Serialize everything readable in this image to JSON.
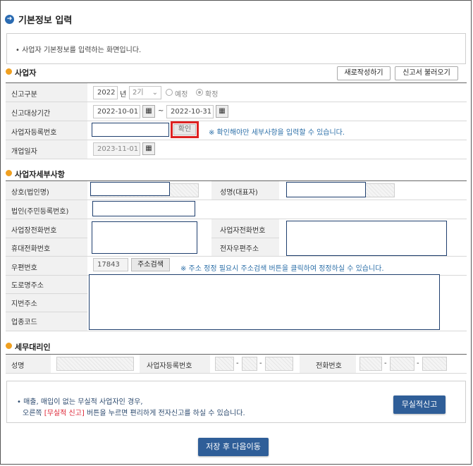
{
  "page": {
    "title": "기본정보 입력",
    "info": "사업자 기본정보를 입력하는 화면입니다."
  },
  "business": {
    "section_title": "사업자",
    "new_button": "새로작성하기",
    "load_button": "신고서 불러오기",
    "report_type": {
      "label": "신고구분",
      "year": "2022",
      "year_suffix": "년",
      "period": "2기",
      "options": [
        "예정",
        "확정"
      ],
      "selected": "확정"
    },
    "report_period": {
      "label": "신고대상기간",
      "start": "2022-10-01",
      "tilde": "~",
      "end": "2022-10-31"
    },
    "reg_number": {
      "label": "사업자등록번호",
      "value": "",
      "confirm_button": "확인",
      "note": "※ 확인해야만 세부사항을 입력할 수 있습니다."
    },
    "open_date": {
      "label": "개업일자",
      "value": "2023-11-01"
    }
  },
  "detail": {
    "section_title": "사업자세부사항",
    "company_name": "상호(법인명)",
    "rep_name": "성명(대표자)",
    "corp_number": "법인(주민등록번호)",
    "biz_phone": "사업장전화번호",
    "biz_owner_phone": "사업자전화번호",
    "mobile": "휴대전화번호",
    "email": "전자우편주소",
    "zip_label": "우편번호",
    "zip_value": "17843",
    "address_search": "주소검색",
    "address_note": "※ 주소 정정 필요시 주소검색 버튼을 클릭하여 정정하실 수 있습니다.",
    "road_address": "도로명주소",
    "lot_address": "지번주소",
    "business_code": "업종코드"
  },
  "tax_agent": {
    "section_title": "세무대리인",
    "name": "성명",
    "reg_number": "사업자등록번호",
    "phone": "전화번호",
    "dash": "-"
  },
  "bottom": {
    "line1": "매출, 매입이 없는 무실적 사업자인 경우,",
    "line2_prefix": "오른쪽",
    "line2_highlight": "[무실적 신고]",
    "line2_suffix": "버튼을 누르면 편리하게 전자신고를 하실 수 있습니다.",
    "no_result_button": "무실적신고",
    "save_next_button": "저장 후 다음이동"
  },
  "colors": {
    "accent_blue": "#2f5e98",
    "section_dot": "#f0a020",
    "highlight_red": "#dd2222",
    "input_border_blue": "#1f3f6e"
  }
}
